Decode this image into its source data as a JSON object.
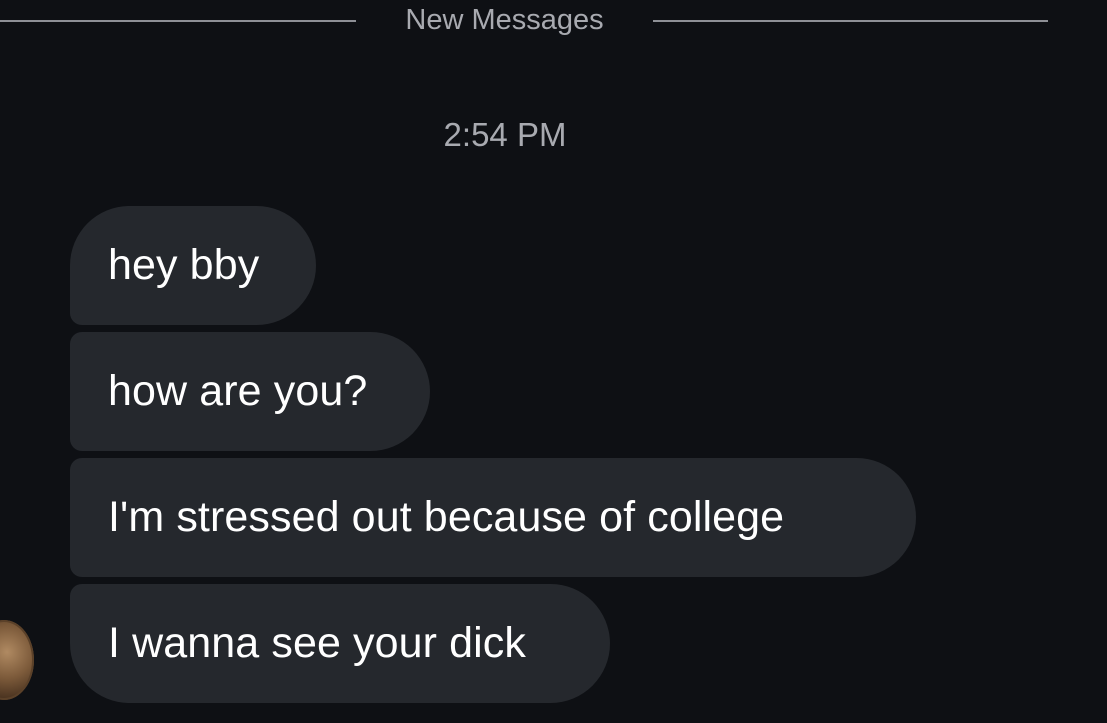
{
  "divider": {
    "label": "New Messages"
  },
  "timestamp": "2:54 PM",
  "messages": [
    {
      "text": "hey bby"
    },
    {
      "text": "how are you?"
    },
    {
      "text": "I'm stressed out because of college"
    },
    {
      "text": "I wanna see your dick"
    }
  ],
  "colors": {
    "background": "#0e1014",
    "bubble": "#25282d",
    "muted_text": "#a8aab0",
    "message_text": "#ffffff"
  }
}
